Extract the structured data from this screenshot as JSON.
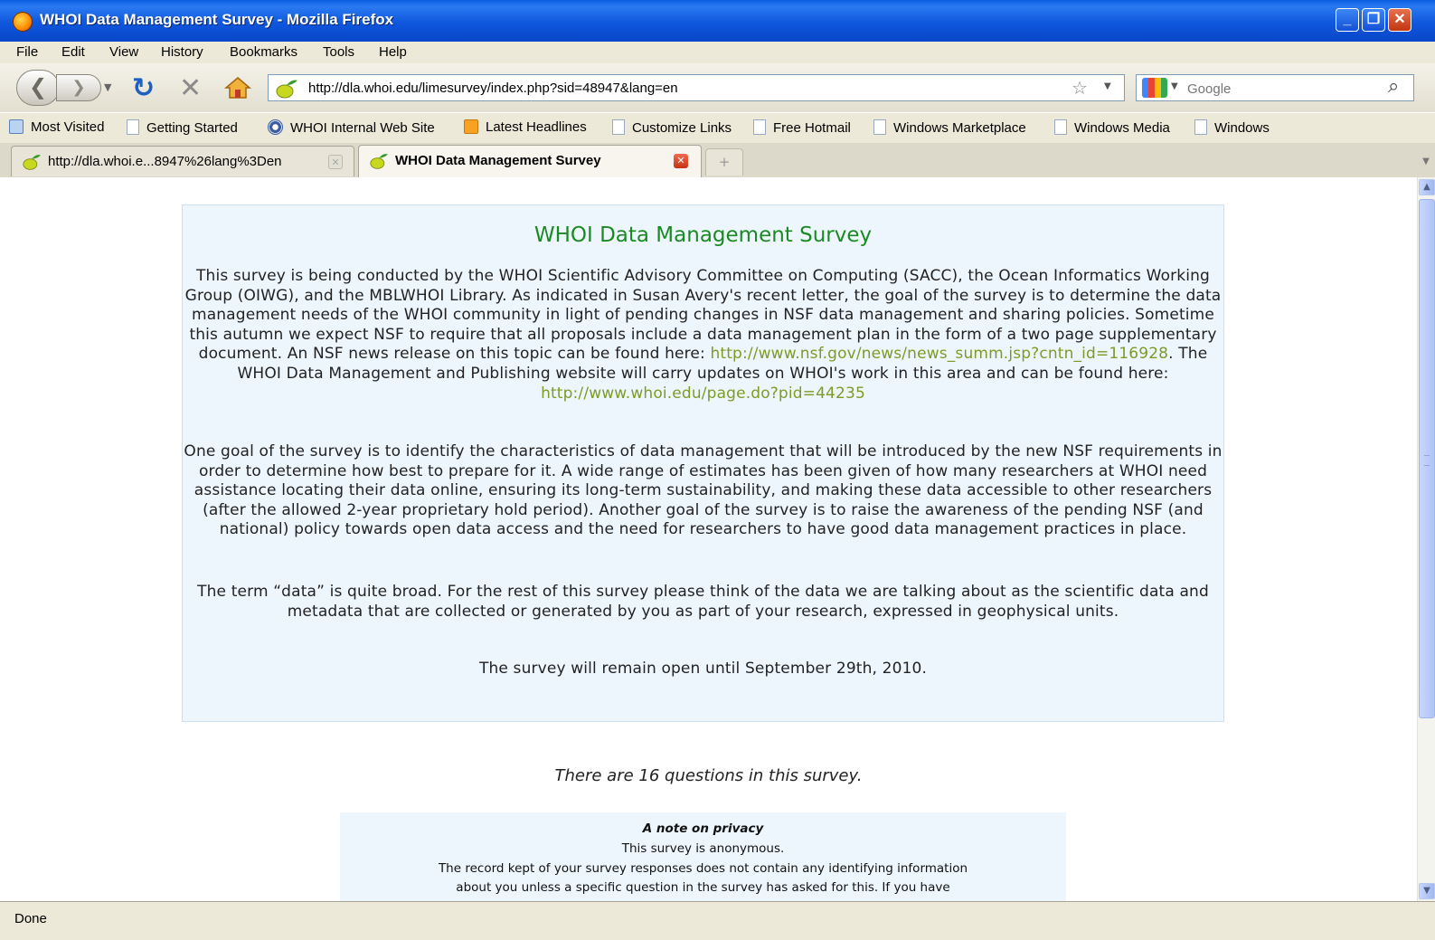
{
  "window": {
    "title": "WHOI Data Management Survey - Mozilla Firefox"
  },
  "menu": [
    "File",
    "Edit",
    "View",
    "History",
    "Bookmarks",
    "Tools",
    "Help"
  ],
  "nav": {
    "url": "http://dla.whoi.edu/limesurvey/index.php?sid=48947&lang=en",
    "search_placeholder": "Google"
  },
  "bookmarks": [
    "Most Visited",
    "Getting Started",
    "WHOI Internal Web Site",
    "Latest Headlines",
    "Customize Links",
    "Free Hotmail",
    "Windows Marketplace",
    "Windows Media",
    "Windows"
  ],
  "tabs": [
    {
      "label": "http://dla.whoi.e...8947%26lang%3Den"
    },
    {
      "label": "WHOI Data Management Survey"
    }
  ],
  "survey": {
    "title": "WHOI Data Management Survey",
    "p1_a": "This survey is being conducted by the WHOI Scientific Advisory Committee on Computing (SACC), the Ocean Informatics Working Group (OIWG), and the MBLWHOI Library. As indicated in Susan Avery's recent letter, the goal of the survey is to determine the data management needs of the WHOI community in light of pending changes in NSF data management and sharing policies.  Sometime this autumn we expect NSF to require that all proposals include a data management plan in the form of a two page supplementary document. An NSF news release on this topic can be found here: ",
    "p1_link1": "http://www.nsf.gov/news/news_summ.jsp?cntn_id=116928",
    "p1_b": ". The WHOI Data Management and Publishing website will carry updates on WHOI's work in this area and can be found here: ",
    "p1_link2": "http://www.whoi.edu/page.do?pid=44235",
    "p2": "One goal of the survey is to identify the characteristics of data management that will be introduced by the new NSF requirements in order to determine how best to prepare for it. A wide range of estimates has been given of how many researchers at WHOI need assistance locating their data online, ensuring its long-term sustainability, and making these data accessible to other researchers (after the allowed 2-year proprietary hold period). Another goal of the survey is to raise the awareness of the pending NSF (and national) policy towards open data access and the need for researchers to have good data management practices in place.",
    "p3": "The term “data” is quite broad. For the rest of this survey please think of the data we are talking about as the scientific data and metadata that are collected or generated by you as part of your research, expressed in geophysical units.",
    "p4": "The survey will remain open until September 29th, 2010.",
    "question_count": "There are 16 questions in this survey.",
    "privacy_heading": "A note on privacy",
    "privacy_line1": "This survey is anonymous.",
    "privacy_line2": "The record kept of your survey responses does not contain any identifying information",
    "privacy_line3": "about you unless a specific question in the survey has asked for this. If you have"
  },
  "status": {
    "text": "Done"
  },
  "colors": {
    "title_green": "#1c8a24",
    "link_green": "#7b9c25",
    "panel_bg": "#eef6fd",
    "titlebar_blue": "#0a5de0"
  }
}
